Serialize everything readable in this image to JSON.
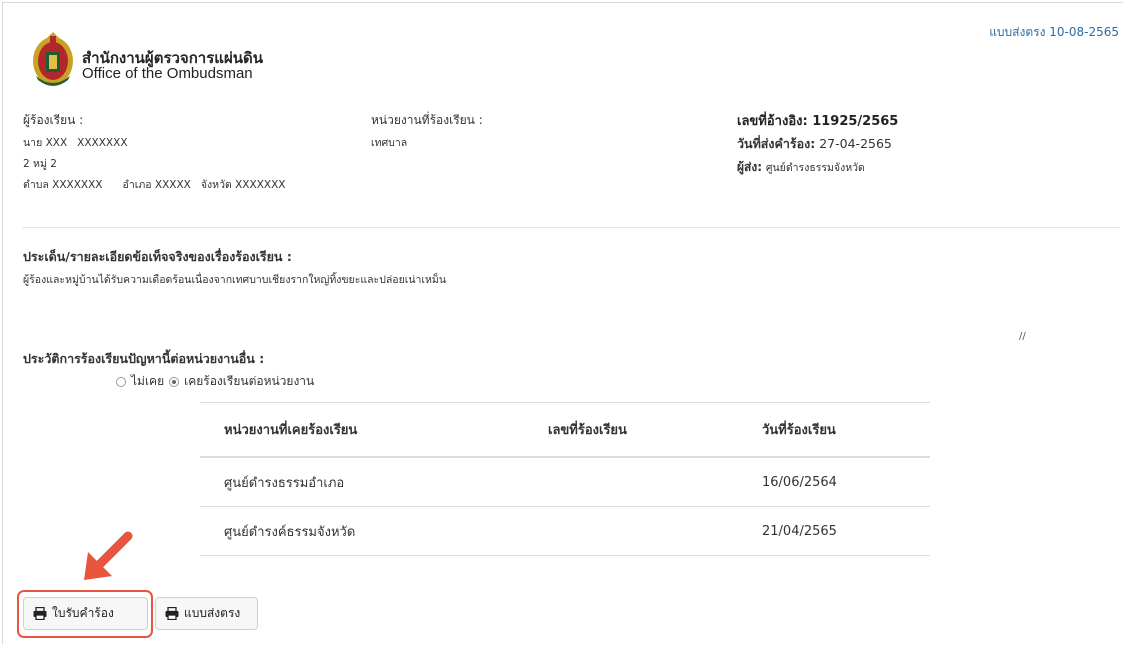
{
  "header": {
    "send_direct_date": "แบบส่งตรง 10-08-2565"
  },
  "org": {
    "name_th": "สำนักงานผู้ตรวจการแผ่นดิน",
    "name_en": "Office of the Ombudsman"
  },
  "complainant": {
    "label": "ผู้ร้องเรียน :",
    "name": "นาย XXX   XXXXXXX",
    "address1": "2 หมู่ 2",
    "address2": "ตำบล XXXXXXX      อำเภอ XXXXX   จังหวัด XXXXXXX"
  },
  "agency": {
    "label": "หน่วยงานที่ร้องเรียน :",
    "value": "เทศบาล"
  },
  "reference": {
    "ref_no": "เลขที่อ้างอิง: 11925/2565",
    "sent_date_label": "วันที่ส่งคำร้อง:",
    "sent_date": "27-04-2565",
    "sender_label": "ผู้ส่ง:",
    "sender": "ศูนย์ดำรงธรรมจังหวัด"
  },
  "issue": {
    "label": "ประเด็น/รายละเอียดข้อเท็จจริงของเรื่องร้องเรียน :",
    "text": "ผู้ร้องและหมู่บ้านได้รับความเดือดร้อนเนื่องจากเทศบาบเชียงรากใหญ่ทิ้งขยะและปล่อยเน่าเหม็น"
  },
  "history": {
    "label": "ประวัติการร้องเรียนปัญหานี้ต่อหน่วยงานอื่น :",
    "option_never": "ไม่เคย",
    "option_ever": "เคยร้องเรียนต่อหน่วยงาน",
    "selected": "option_ever",
    "columns": [
      "หน่วยงานที่เคยร้องเรียน",
      "เลขที่ร้องเรียน",
      "วันที่ร้องเรียน"
    ],
    "rows": [
      [
        "ศูนย์ดำรงธรรมอำเภอ",
        "",
        "16/06/2564"
      ],
      [
        "ศูนย์ดำรงค์ธรรมจังหวัด",
        "",
        "21/04/2565"
      ]
    ]
  },
  "buttons": {
    "receipt": "ใบรับคำร้อง",
    "send_direct": "แบบส่งตรง"
  },
  "colors": {
    "highlight": "#e8553e",
    "link": "#2d6ca2"
  },
  "icons": {
    "print": "printer-icon",
    "annotation": "arrow-icon"
  }
}
